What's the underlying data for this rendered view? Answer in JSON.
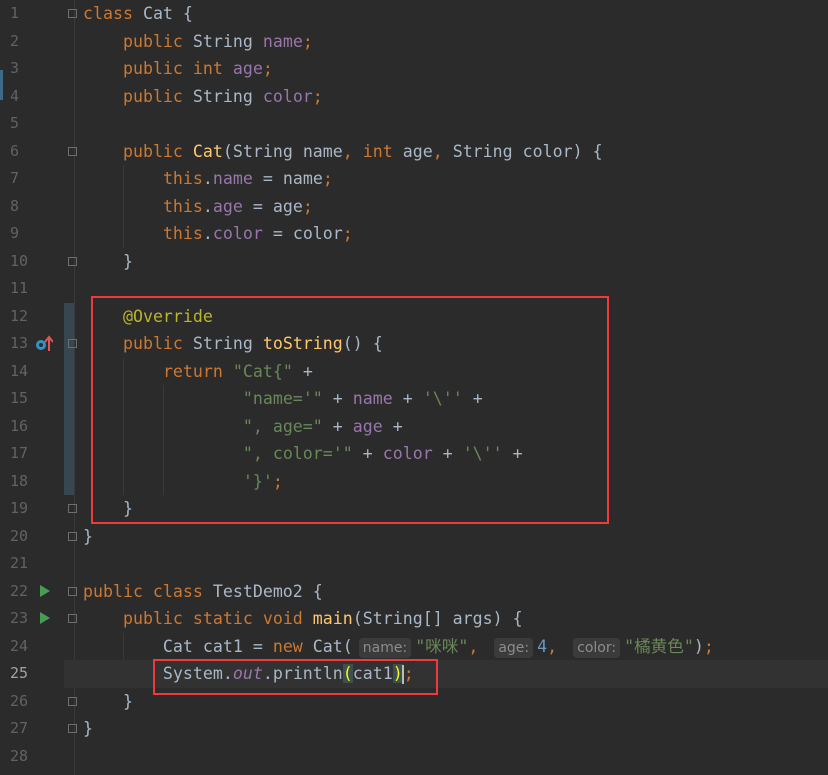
{
  "editor": {
    "theme": "darcula",
    "current_line": 25,
    "colors": {
      "background": "#2b2b2b",
      "keyword": "#cc7832",
      "string": "#6a8759",
      "field": "#9876aa",
      "method": "#ffc66d",
      "annotation": "#bbb529",
      "number": "#6897bb",
      "highlight_box": "#f0393a"
    },
    "gutter_icons": [
      {
        "line": 13,
        "icon": "override-method-icon"
      },
      {
        "line": 22,
        "icon": "run-icon"
      },
      {
        "line": 23,
        "icon": "run-icon"
      }
    ]
  },
  "lines": [
    {
      "n": "1",
      "tokens": [
        [
          "k",
          "class "
        ],
        [
          "t",
          "Cat {"
        ]
      ]
    },
    {
      "n": "2",
      "tokens": [
        [
          "t",
          "    "
        ],
        [
          "k",
          "public "
        ],
        [
          "t",
          "String "
        ],
        [
          "f",
          "name"
        ],
        [
          "k",
          ";"
        ]
      ]
    },
    {
      "n": "3",
      "tokens": [
        [
          "t",
          "    "
        ],
        [
          "k",
          "public int "
        ],
        [
          "f",
          "age"
        ],
        [
          "k",
          ";"
        ]
      ]
    },
    {
      "n": "4",
      "tokens": [
        [
          "t",
          "    "
        ],
        [
          "k",
          "public "
        ],
        [
          "t",
          "String "
        ],
        [
          "f",
          "color"
        ],
        [
          "k",
          ";"
        ]
      ]
    },
    {
      "n": "5",
      "tokens": []
    },
    {
      "n": "6",
      "tokens": [
        [
          "t",
          "    "
        ],
        [
          "k",
          "public "
        ],
        [
          "m",
          "Cat"
        ],
        [
          "t",
          "(String name"
        ],
        [
          "k",
          ", int "
        ],
        [
          "t",
          "age"
        ],
        [
          "k",
          ", "
        ],
        [
          "t",
          "String color) {"
        ]
      ]
    },
    {
      "n": "7",
      "tokens": [
        [
          "t",
          "        "
        ],
        [
          "k",
          "this"
        ],
        [
          "t",
          "."
        ],
        [
          "f",
          "name"
        ],
        [
          "t",
          " = name"
        ],
        [
          "k",
          ";"
        ]
      ]
    },
    {
      "n": "8",
      "tokens": [
        [
          "t",
          "        "
        ],
        [
          "k",
          "this"
        ],
        [
          "t",
          "."
        ],
        [
          "f",
          "age"
        ],
        [
          "t",
          " = age"
        ],
        [
          "k",
          ";"
        ]
      ]
    },
    {
      "n": "9",
      "tokens": [
        [
          "t",
          "        "
        ],
        [
          "k",
          "this"
        ],
        [
          "t",
          "."
        ],
        [
          "f",
          "color"
        ],
        [
          "t",
          " = color"
        ],
        [
          "k",
          ";"
        ]
      ]
    },
    {
      "n": "10",
      "tokens": [
        [
          "t",
          "    }"
        ]
      ]
    },
    {
      "n": "11",
      "tokens": []
    },
    {
      "n": "12",
      "tokens": [
        [
          "t",
          "    "
        ],
        [
          "a",
          "@Override"
        ]
      ]
    },
    {
      "n": "13",
      "tokens": [
        [
          "t",
          "    "
        ],
        [
          "k",
          "public "
        ],
        [
          "t",
          "String "
        ],
        [
          "m",
          "toString"
        ],
        [
          "t",
          "() {"
        ]
      ]
    },
    {
      "n": "14",
      "tokens": [
        [
          "t",
          "        "
        ],
        [
          "k",
          "return "
        ],
        [
          "s",
          "\"Cat{\""
        ],
        [
          "t",
          " +"
        ]
      ]
    },
    {
      "n": "15",
      "tokens": [
        [
          "t",
          "                "
        ],
        [
          "s",
          "\"name='\""
        ],
        [
          "t",
          " + "
        ],
        [
          "f",
          "name"
        ],
        [
          "t",
          " + "
        ],
        [
          "s",
          "'\\''"
        ],
        [
          "t",
          " +"
        ]
      ]
    },
    {
      "n": "16",
      "tokens": [
        [
          "t",
          "                "
        ],
        [
          "s",
          "\", age=\""
        ],
        [
          "t",
          " + "
        ],
        [
          "f",
          "age"
        ],
        [
          "t",
          " +"
        ]
      ]
    },
    {
      "n": "17",
      "tokens": [
        [
          "t",
          "                "
        ],
        [
          "s",
          "\", color='\""
        ],
        [
          "t",
          " + "
        ],
        [
          "f",
          "color"
        ],
        [
          "t",
          " + "
        ],
        [
          "s",
          "'\\''"
        ],
        [
          "t",
          " +"
        ]
      ]
    },
    {
      "n": "18",
      "tokens": [
        [
          "t",
          "                "
        ],
        [
          "s",
          "'}'"
        ],
        [
          "k",
          ";"
        ]
      ]
    },
    {
      "n": "19",
      "tokens": [
        [
          "t",
          "    }"
        ]
      ]
    },
    {
      "n": "20",
      "tokens": [
        [
          "t",
          "}"
        ]
      ]
    },
    {
      "n": "21",
      "tokens": []
    },
    {
      "n": "22",
      "tokens": [
        [
          "k",
          "public class "
        ],
        [
          "t",
          "TestDemo2 {"
        ]
      ]
    },
    {
      "n": "23",
      "tokens": [
        [
          "t",
          "    "
        ],
        [
          "k",
          "public static void "
        ],
        [
          "m",
          "main"
        ],
        [
          "t",
          "(String[] args) {"
        ]
      ]
    },
    {
      "n": "24",
      "tokens": [
        [
          "t",
          "        Cat cat1 = "
        ],
        [
          "k",
          "new "
        ],
        [
          "t",
          "Cat("
        ],
        [
          "h",
          "name:"
        ],
        [
          "s",
          "\"咪咪\""
        ],
        [
          "k",
          ", "
        ],
        [
          "h",
          "age:"
        ],
        [
          "n",
          "4"
        ],
        [
          "k",
          ", "
        ],
        [
          "h",
          "color:"
        ],
        [
          "s",
          "\"橘黄色\""
        ],
        [
          "t",
          ")"
        ],
        [
          "k",
          ";"
        ]
      ]
    },
    {
      "n": "25",
      "tokens": [
        [
          "t",
          "        System."
        ],
        [
          "sf",
          "out"
        ],
        [
          "t",
          ".println"
        ],
        [
          "br",
          "("
        ],
        [
          "t",
          "cat1"
        ],
        [
          "br",
          ")"
        ],
        [
          "caret",
          ""
        ],
        [
          "k",
          ";"
        ]
      ]
    },
    {
      "n": "26",
      "tokens": [
        [
          "t",
          "    }"
        ]
      ]
    },
    {
      "n": "27",
      "tokens": [
        [
          "t",
          "}"
        ]
      ]
    },
    {
      "n": "28",
      "tokens": []
    }
  ]
}
